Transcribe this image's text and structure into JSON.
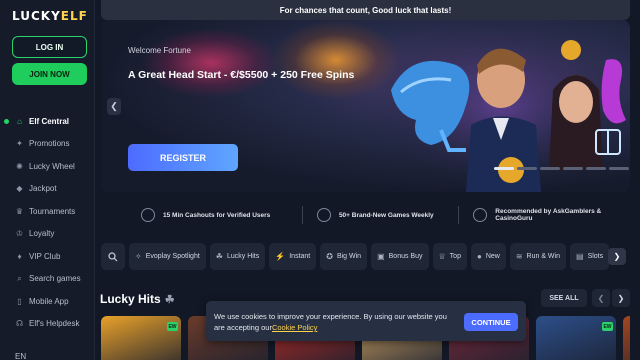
{
  "brand": {
    "logo_left": "LUCKY",
    "logo_right": "ELF"
  },
  "auth": {
    "login_label": "LOG IN",
    "join_label": "JOIN NOW"
  },
  "sidebar": {
    "items": [
      {
        "label": "Elf Central",
        "icon": "home-icon",
        "glyph": "⌂",
        "active": true
      },
      {
        "label": "Promotions",
        "icon": "gift-icon",
        "glyph": "✦"
      },
      {
        "label": "Lucky Wheel",
        "icon": "wheel-icon",
        "glyph": "✺"
      },
      {
        "label": "Jackpot",
        "icon": "diamond-icon",
        "glyph": "◆"
      },
      {
        "label": "Tournaments",
        "icon": "trophy-icon",
        "glyph": "♛"
      },
      {
        "label": "Loyalty",
        "icon": "crown-icon",
        "glyph": "♔"
      },
      {
        "label": "VIP Club",
        "icon": "vip-icon",
        "glyph": "♦"
      },
      {
        "label": "Search games",
        "icon": "search-icon",
        "glyph": "⌕"
      },
      {
        "label": "Mobile App",
        "icon": "phone-icon",
        "glyph": "▯"
      },
      {
        "label": "Elf's Helpdesk",
        "icon": "headset-icon",
        "glyph": "☊"
      }
    ],
    "language": "EN"
  },
  "topbar": {
    "text": "For chances that count, Good luck that lasts!"
  },
  "hero": {
    "subtitle": "Welcome Fortune",
    "title": "A Great Head Start - €/$5500 + 250 Free Spins",
    "cta": "REGISTER",
    "slides": 6,
    "active_slide": 1
  },
  "features": [
    {
      "text": "15 Min Cashouts for Verified Users",
      "icon": "timer-icon"
    },
    {
      "text": "50+ Brand-New Games Weekly",
      "icon": "sparkle-icon"
    },
    {
      "text": "Recommended by AskGamblers & CasinoGuru",
      "icon": "medal-icon"
    }
  ],
  "categories": [
    {
      "label": "Evoplay Spotlight",
      "icon": "spotlight-icon",
      "glyph": "✧"
    },
    {
      "label": "Lucky Hits",
      "icon": "hits-icon",
      "glyph": "☘"
    },
    {
      "label": "Instant",
      "icon": "bolt-icon",
      "glyph": "⚡"
    },
    {
      "label": "Big Win",
      "icon": "bigwin-icon",
      "glyph": "✪"
    },
    {
      "label": "Bonus Buy",
      "icon": "bonus-icon",
      "glyph": "▣"
    },
    {
      "label": "Top",
      "icon": "top-icon",
      "glyph": "♕"
    },
    {
      "label": "New",
      "icon": "new-icon",
      "glyph": "●"
    },
    {
      "label": "Run & Win",
      "icon": "run-icon",
      "glyph": "≋"
    },
    {
      "label": "Slots",
      "icon": "slots-icon",
      "glyph": "▤"
    }
  ],
  "section": {
    "title": "Lucky Hits",
    "see_all": "SEE ALL"
  },
  "games": [
    {
      "color": "#e9a12a",
      "badge": "EW"
    },
    {
      "color": "#6b3b2a",
      "badge": ""
    },
    {
      "color": "#b32c26",
      "badge": "EW"
    },
    {
      "color": "#caa063",
      "badge": ""
    },
    {
      "color": "#7a2a3a",
      "badge": ""
    },
    {
      "color": "#2d4f8a",
      "badge": "EW"
    },
    {
      "color": "#a3461f",
      "badge": ""
    }
  ],
  "cookie": {
    "text": "We use cookies to improve your experience. By using our website you are accepting our",
    "link": "Cookie Policy",
    "button": "CONTINUE"
  },
  "colors": {
    "accent_green": "#25d366",
    "accent_blue": "#4c6bff",
    "gold": "#ffd34d"
  }
}
